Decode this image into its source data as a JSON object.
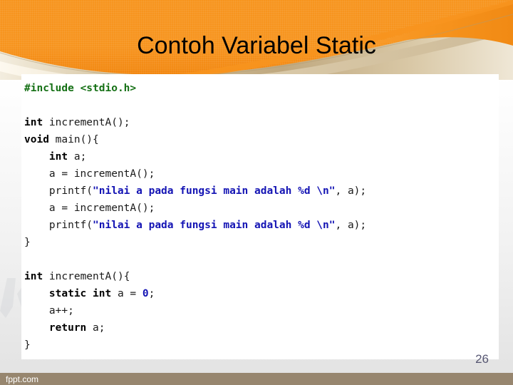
{
  "slide": {
    "title": "Contoh Variabel Static",
    "page_number": "26",
    "watermark": "fppt.com",
    "colors": {
      "header_orange": "#F7941E",
      "swoosh_tan": "#C9B189",
      "title_text": "#000000",
      "code_preprocessor_green": "#157015",
      "code_string_blue": "#1414B4",
      "code_keyword_black": "#000000",
      "bottom_bar_tan": "#97866F",
      "page_number_color": "#3B3B5C"
    }
  },
  "code": {
    "language": "c",
    "lines": [
      {
        "indent": 0,
        "tokens": [
          {
            "t": "#include <stdio.h>",
            "c": "pre"
          }
        ]
      },
      {
        "indent": 0,
        "tokens": []
      },
      {
        "indent": 0,
        "tokens": [
          {
            "t": "int",
            "c": "kw"
          },
          {
            "t": " incrementA();",
            "c": "plain"
          }
        ]
      },
      {
        "indent": 0,
        "tokens": [
          {
            "t": "void",
            "c": "kw"
          },
          {
            "t": " main(){",
            "c": "plain"
          }
        ]
      },
      {
        "indent": 1,
        "tokens": [
          {
            "t": "int",
            "c": "kw"
          },
          {
            "t": " a;",
            "c": "plain"
          }
        ]
      },
      {
        "indent": 1,
        "tokens": [
          {
            "t": "a = incrementA();",
            "c": "plain"
          }
        ]
      },
      {
        "indent": 1,
        "tokens": [
          {
            "t": "printf(",
            "c": "plain"
          },
          {
            "t": "\"nilai a pada fungsi main adalah %d \\n\"",
            "c": "str"
          },
          {
            "t": ", a);",
            "c": "plain"
          }
        ]
      },
      {
        "indent": 1,
        "tokens": [
          {
            "t": "a = incrementA();",
            "c": "plain"
          }
        ]
      },
      {
        "indent": 1,
        "tokens": [
          {
            "t": "printf(",
            "c": "plain"
          },
          {
            "t": "\"nilai a pada fungsi main adalah %d \\n\"",
            "c": "str"
          },
          {
            "t": ", a);",
            "c": "plain"
          }
        ]
      },
      {
        "indent": 0,
        "tokens": [
          {
            "t": "}",
            "c": "plain"
          }
        ]
      },
      {
        "indent": 0,
        "tokens": []
      },
      {
        "indent": 0,
        "tokens": [
          {
            "t": "int",
            "c": "kw"
          },
          {
            "t": " incrementA(){",
            "c": "plain"
          }
        ]
      },
      {
        "indent": 1,
        "tokens": [
          {
            "t": "static int",
            "c": "kw"
          },
          {
            "t": " a = ",
            "c": "plain"
          },
          {
            "t": "0",
            "c": "num"
          },
          {
            "t": ";",
            "c": "plain"
          }
        ]
      },
      {
        "indent": 1,
        "tokens": [
          {
            "t": "a++;",
            "c": "plain"
          }
        ]
      },
      {
        "indent": 1,
        "tokens": [
          {
            "t": "return",
            "c": "kw"
          },
          {
            "t": " a;",
            "c": "plain"
          }
        ]
      },
      {
        "indent": 0,
        "tokens": [
          {
            "t": "}",
            "c": "plain"
          }
        ]
      }
    ]
  }
}
